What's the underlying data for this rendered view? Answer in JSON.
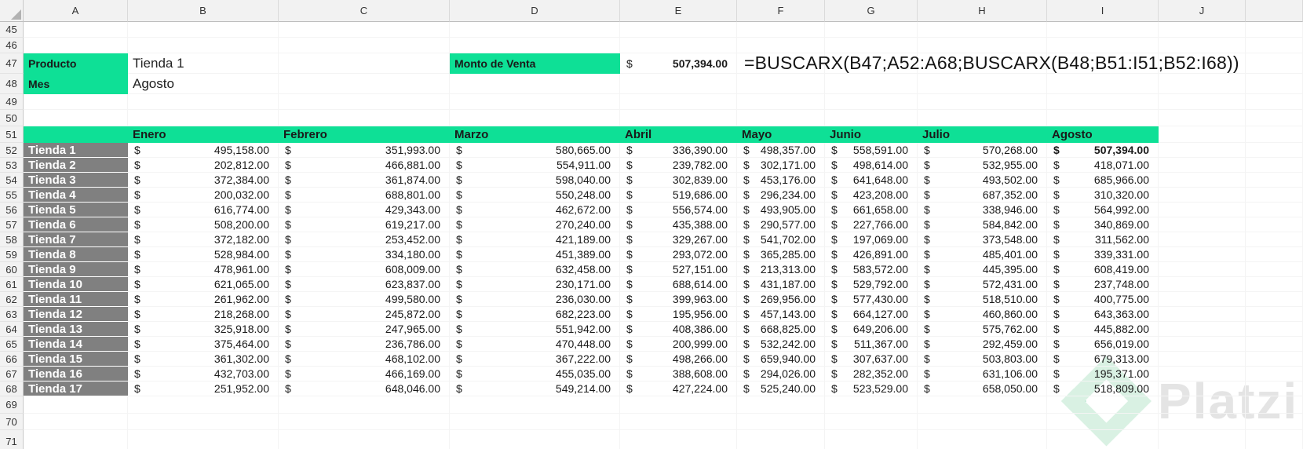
{
  "sheet": {
    "column_letters": [
      "A",
      "B",
      "C",
      "D",
      "E",
      "F",
      "G",
      "H",
      "I",
      "J"
    ],
    "row_numbers": [
      45,
      46,
      47,
      48,
      49,
      50,
      51,
      52,
      53,
      54,
      55,
      56,
      57,
      58,
      59,
      60,
      61,
      62,
      63,
      64,
      65,
      66,
      67,
      68,
      69,
      70,
      71
    ]
  },
  "colors": {
    "accent_green": "#0EE096",
    "store_gray": "#808080",
    "header_bg": "#F2F2F2",
    "watermark_text_gray": "#E4E4E4",
    "watermark_logo_green": "#D9F1E3",
    "watermark_logo_accent": "#BDE9D2"
  },
  "lookup": {
    "producto_label": "Producto",
    "producto_value": "Tienda 1",
    "mes_label": "Mes",
    "mes_value": "Agosto",
    "monto_label": "Monto de Venta",
    "currency": "$",
    "monto_value": "507,394.00",
    "formula": "=BUSCARX(B47;A52:A68;BUSCARX(B48;B51:I51;B52:I68))"
  },
  "table": {
    "month_headers": [
      "Enero",
      "Febrero",
      "Marzo",
      "Abril",
      "Mayo",
      "Junio",
      "Julio",
      "Agosto"
    ],
    "currency": "$",
    "first_store_row_number": 52,
    "highlighted_cell": {
      "store": "Tienda 1",
      "month": "Agosto"
    },
    "stores": [
      {
        "name": "Tienda 1",
        "values": [
          "495,158.00",
          "351,993.00",
          "580,665.00",
          "336,390.00",
          "498,357.00",
          "558,591.00",
          "570,268.00",
          "507,394.00"
        ]
      },
      {
        "name": "Tienda 2",
        "values": [
          "202,812.00",
          "466,881.00",
          "554,911.00",
          "239,782.00",
          "302,171.00",
          "498,614.00",
          "532,955.00",
          "418,071.00"
        ]
      },
      {
        "name": "Tienda 3",
        "values": [
          "372,384.00",
          "361,874.00",
          "598,040.00",
          "302,839.00",
          "453,176.00",
          "641,648.00",
          "493,502.00",
          "685,966.00"
        ]
      },
      {
        "name": "Tienda 4",
        "values": [
          "200,032.00",
          "688,801.00",
          "550,248.00",
          "519,686.00",
          "296,234.00",
          "423,208.00",
          "687,352.00",
          "310,320.00"
        ]
      },
      {
        "name": "Tienda 5",
        "values": [
          "616,774.00",
          "429,343.00",
          "462,672.00",
          "556,574.00",
          "493,905.00",
          "661,658.00",
          "338,946.00",
          "564,992.00"
        ]
      },
      {
        "name": "Tienda 6",
        "values": [
          "508,200.00",
          "619,217.00",
          "270,240.00",
          "435,388.00",
          "290,577.00",
          "227,766.00",
          "584,842.00",
          "340,869.00"
        ]
      },
      {
        "name": "Tienda 7",
        "values": [
          "372,182.00",
          "253,452.00",
          "421,189.00",
          "329,267.00",
          "541,702.00",
          "197,069.00",
          "373,548.00",
          "311,562.00"
        ]
      },
      {
        "name": "Tienda 8",
        "values": [
          "528,984.00",
          "334,180.00",
          "451,389.00",
          "293,072.00",
          "365,285.00",
          "426,891.00",
          "485,401.00",
          "339,331.00"
        ]
      },
      {
        "name": "Tienda 9",
        "values": [
          "478,961.00",
          "608,009.00",
          "632,458.00",
          "527,151.00",
          "213,313.00",
          "583,572.00",
          "445,395.00",
          "608,419.00"
        ]
      },
      {
        "name": "Tienda 10",
        "values": [
          "621,065.00",
          "623,837.00",
          "230,171.00",
          "688,614.00",
          "431,187.00",
          "529,792.00",
          "572,431.00",
          "237,748.00"
        ]
      },
      {
        "name": "Tienda 11",
        "values": [
          "261,962.00",
          "499,580.00",
          "236,030.00",
          "399,963.00",
          "269,956.00",
          "577,430.00",
          "518,510.00",
          "400,775.00"
        ]
      },
      {
        "name": "Tienda 12",
        "values": [
          "218,268.00",
          "245,872.00",
          "682,223.00",
          "195,956.00",
          "457,143.00",
          "664,127.00",
          "460,860.00",
          "643,363.00"
        ]
      },
      {
        "name": "Tienda 13",
        "values": [
          "325,918.00",
          "247,965.00",
          "551,942.00",
          "408,386.00",
          "668,825.00",
          "649,206.00",
          "575,762.00",
          "445,882.00"
        ]
      },
      {
        "name": "Tienda 14",
        "values": [
          "375,464.00",
          "236,786.00",
          "470,448.00",
          "200,999.00",
          "532,242.00",
          "511,367.00",
          "292,459.00",
          "656,019.00"
        ]
      },
      {
        "name": "Tienda 15",
        "values": [
          "361,302.00",
          "468,102.00",
          "367,222.00",
          "498,266.00",
          "659,940.00",
          "307,637.00",
          "503,803.00",
          "679,313.00"
        ]
      },
      {
        "name": "Tienda 16",
        "values": [
          "432,703.00",
          "466,169.00",
          "455,035.00",
          "388,608.00",
          "294,026.00",
          "282,352.00",
          "631,106.00",
          "195,371.00"
        ]
      },
      {
        "name": "Tienda 17",
        "values": [
          "251,952.00",
          "648,046.00",
          "549,214.00",
          "427,224.00",
          "525,240.00",
          "523,529.00",
          "658,050.00",
          "518,809.00"
        ]
      }
    ]
  },
  "watermark": {
    "text": "Platzi"
  }
}
